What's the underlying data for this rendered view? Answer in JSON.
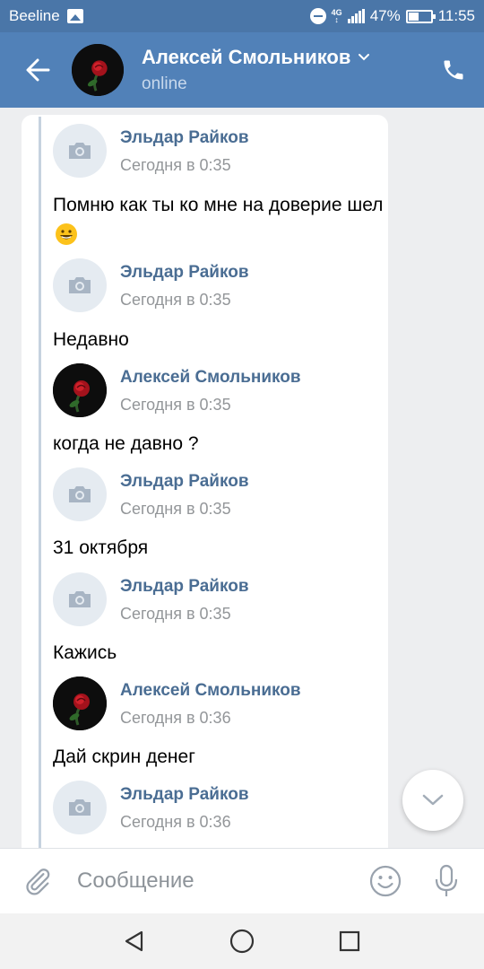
{
  "status_bar": {
    "carrier": "Beeline",
    "network": "4G",
    "battery_percent": "47%",
    "battery_level": 0.47,
    "time": "11:55"
  },
  "header": {
    "name": "Алексей Смольников",
    "status": "online"
  },
  "messages": [
    {
      "sender": "Эльдар Райков",
      "time": "Сегодня в 0:35",
      "avatar": "camera-placeholder",
      "text": "Помню как ты ко мне на доверие шел",
      "emoji": "grinning-face"
    },
    {
      "sender": "Эльдар Райков",
      "time": "Сегодня в 0:35",
      "avatar": "camera-placeholder",
      "text": "Недавно"
    },
    {
      "sender": "Алексей Смольников",
      "time": "Сегодня в 0:35",
      "avatar": "rose-photo",
      "text": "когда не давно ?"
    },
    {
      "sender": "Эльдар Райков",
      "time": "Сегодня в 0:35",
      "avatar": "camera-placeholder",
      "text": "31 октября"
    },
    {
      "sender": "Эльдар Райков",
      "time": "Сегодня в 0:35",
      "avatar": "camera-placeholder",
      "text": "Кажись"
    },
    {
      "sender": "Алексей Смольников",
      "time": "Сегодня в 0:36",
      "avatar": "rose-photo",
      "text": "Дай скрин денег"
    },
    {
      "sender": "Эльдар Райков",
      "time": "Сегодня в 0:36",
      "avatar": "camera-placeholder",
      "text": ""
    }
  ],
  "composer": {
    "placeholder": "Сообщение"
  },
  "colors": {
    "header_bg": "#5181b8",
    "status_bg": "#4a76a8",
    "sender_name": "#4a6d93",
    "time_text": "#939699",
    "chat_bg": "#edeef0"
  }
}
